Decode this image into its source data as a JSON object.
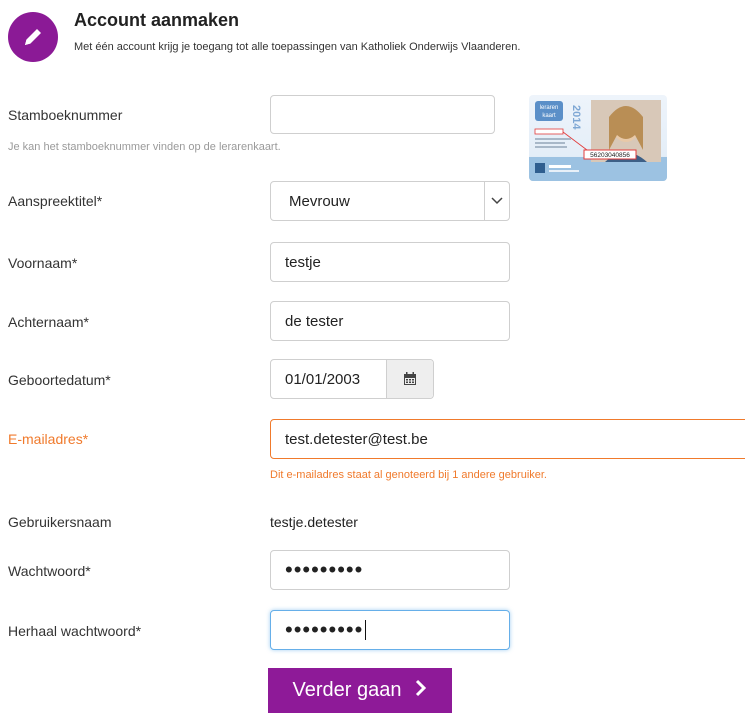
{
  "header": {
    "title": "Account aanmaken",
    "subtitle": "Met één account krijg je toegang tot alle toepassingen van Katholiek Onderwijs Vlaanderen.",
    "icon": "pencil-icon"
  },
  "form": {
    "stamboeknummer": {
      "label": "Stamboeknummer",
      "value": "",
      "hint": "Je kan het stamboeknummer vinden op de lerarenkaart."
    },
    "aanspreektitel": {
      "label": "Aanspreektitel*",
      "value": "Mevrouw"
    },
    "voornaam": {
      "label": "Voornaam*",
      "value": "testje"
    },
    "achternaam": {
      "label": "Achternaam*",
      "value": "de tester"
    },
    "geboortedatum": {
      "label": "Geboortedatum*",
      "value": "01/01/2003",
      "icon": "calendar-icon"
    },
    "email": {
      "label": "E-mailadres*",
      "value": "test.detester@test.be",
      "error": "Dit e-mailadres staat al genoteerd bij 1 andere gebruiker."
    },
    "gebruikersnaam": {
      "label": "Gebruikersnaam",
      "value": "testje.detester"
    },
    "wachtwoord": {
      "label": "Wachtwoord*",
      "value": "•••••••••"
    },
    "herhaal": {
      "label": "Herhaal wachtwoord*",
      "value": "•••••••••"
    }
  },
  "card": {
    "brand": "leraren kaart",
    "year": "2014",
    "number": "56203040856"
  },
  "button": {
    "label": "Verder gaan",
    "icon": "chevron-right-icon"
  },
  "colors": {
    "brand": "#8e1a98",
    "error": "#f07a2c",
    "focus": "#66afe9"
  }
}
